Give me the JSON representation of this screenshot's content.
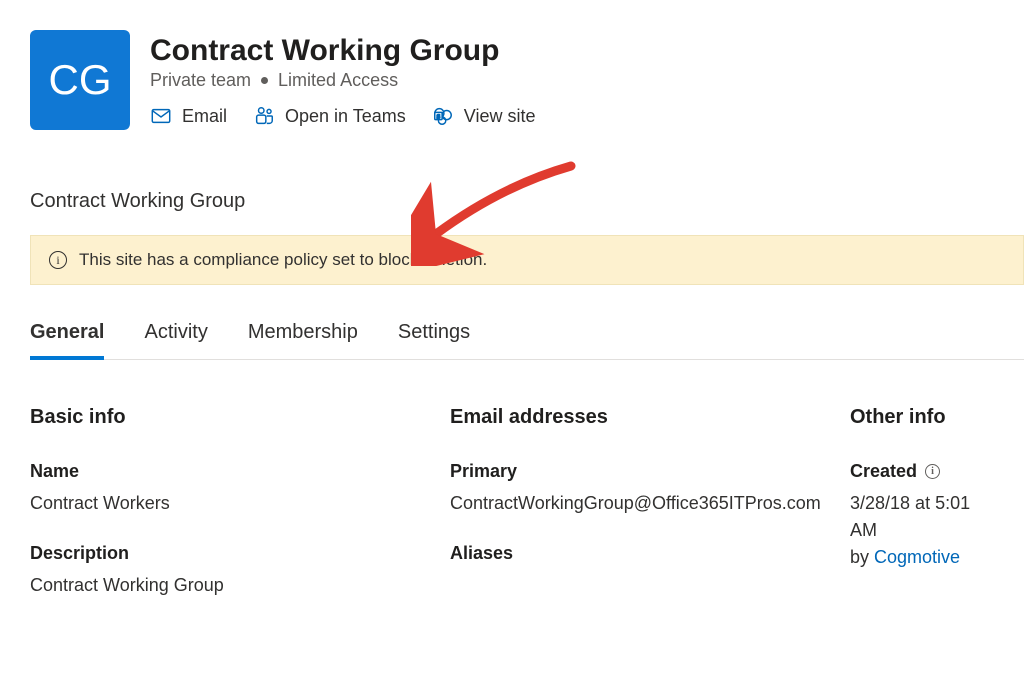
{
  "header": {
    "avatar_initials": "CG",
    "title": "Contract Working Group",
    "privacy": "Private team",
    "access": "Limited Access",
    "actions": {
      "email": "Email",
      "open_in_teams": "Open in Teams",
      "view_site": "View site"
    }
  },
  "subheading": "Contract Working Group",
  "notice": {
    "message": "This site has a compliance policy set to block deletion."
  },
  "tabs": {
    "general": "General",
    "activity": "Activity",
    "membership": "Membership",
    "settings": "Settings"
  },
  "basic_info": {
    "section": "Basic info",
    "name_label": "Name",
    "name_value": "Contract Workers",
    "description_label": "Description",
    "description_value": "Contract Working Group"
  },
  "email_addresses": {
    "section": "Email addresses",
    "primary_label": "Primary",
    "primary_value": "ContractWorkingGroup@Office365ITPros.com",
    "aliases_label": "Aliases"
  },
  "other_info": {
    "section": "Other info",
    "created_label": "Created",
    "created_line1": "3/28/18 at 5:01 AM",
    "created_by_prefix": "by ",
    "created_by_link": "Cogmotive"
  }
}
